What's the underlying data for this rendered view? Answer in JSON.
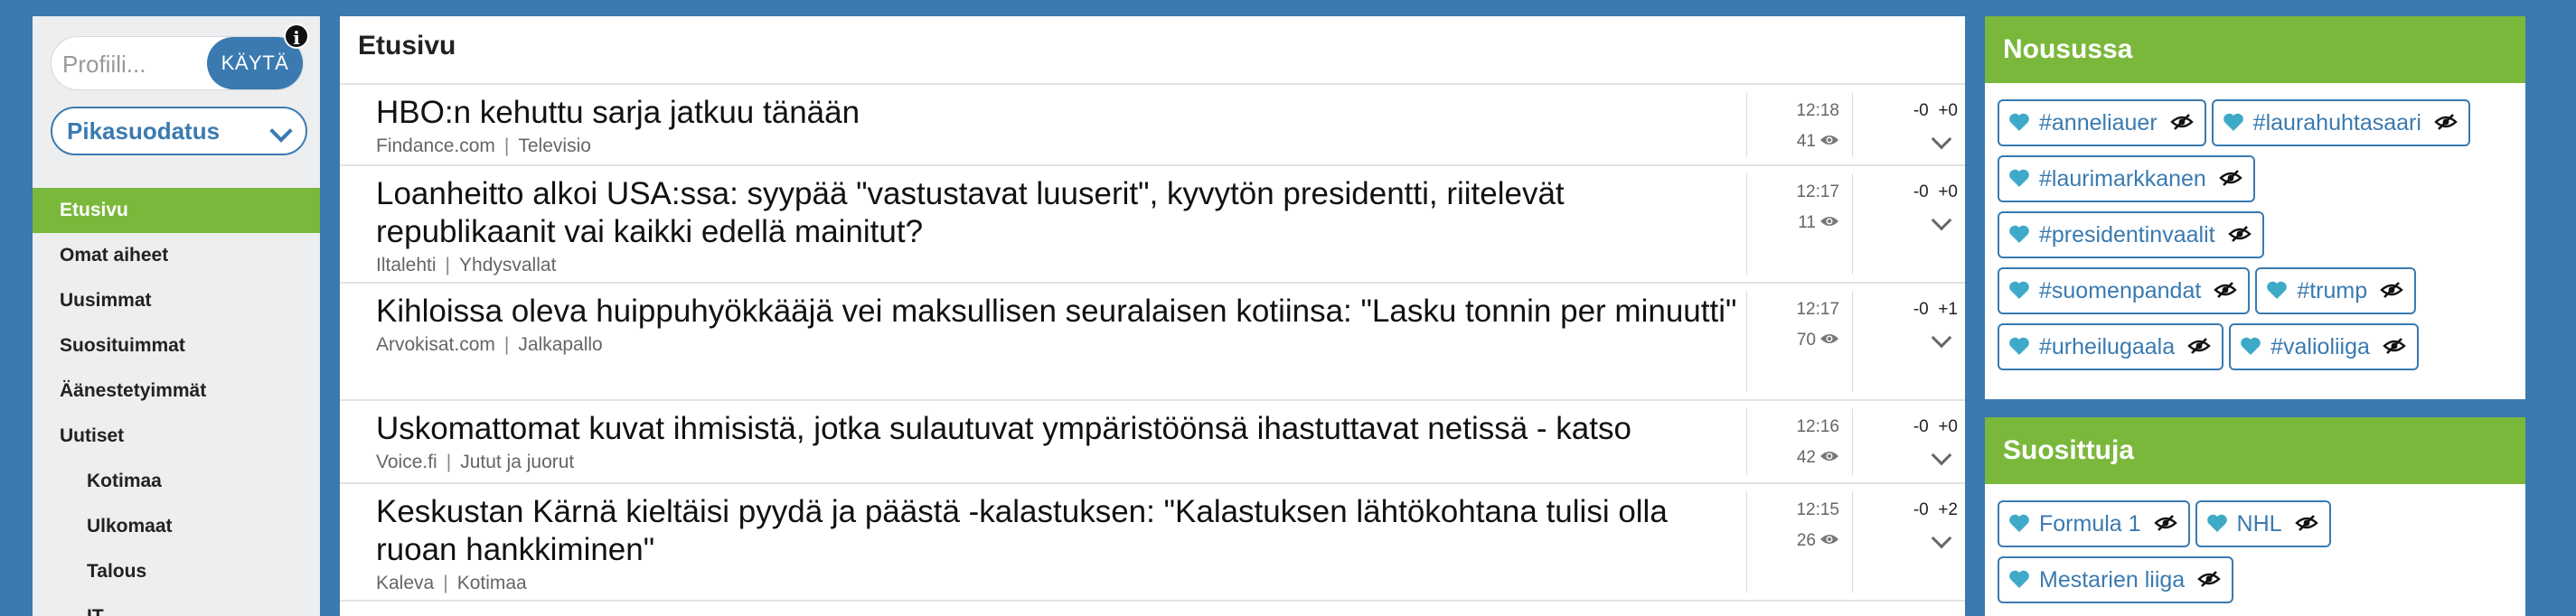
{
  "sidebar": {
    "search": {
      "placeholder": "Profiili...",
      "button_label": "KÄYTÄ"
    },
    "info_icon": "info-icon",
    "quickfilter_label": "Pikasuodatus",
    "nav": [
      {
        "label": "Etusivu",
        "active": true,
        "sub": false
      },
      {
        "label": "Omat aiheet",
        "active": false,
        "sub": false
      },
      {
        "label": "Uusimmat",
        "active": false,
        "sub": false
      },
      {
        "label": "Suosituimmat",
        "active": false,
        "sub": false
      },
      {
        "label": "Äänestetyimmät",
        "active": false,
        "sub": false
      },
      {
        "label": "Uutiset",
        "active": false,
        "sub": false
      },
      {
        "label": "Kotimaa",
        "active": false,
        "sub": true
      },
      {
        "label": "Ulkomaat",
        "active": false,
        "sub": true
      },
      {
        "label": "Talous",
        "active": false,
        "sub": true
      },
      {
        "label": "IT",
        "active": false,
        "sub": true
      }
    ]
  },
  "main": {
    "title": "Etusivu",
    "articles": [
      {
        "title": "HBO:n kehuttu sarja jatkuu tänään",
        "source": "Findance.com",
        "category": "Televisio",
        "time": "12:18",
        "views": "41",
        "down": "-0",
        "up": "+0"
      },
      {
        "title": "Loanheitto alkoi USA:ssa: syypää \"vastustavat luuserit\", kyvytön presidentti, riitelevät republikaanit vai kaikki edellä mainitut?",
        "source": "Iltalehti",
        "category": "Yhdysvallat",
        "time": "12:17",
        "views": "11",
        "down": "-0",
        "up": "+0"
      },
      {
        "title": "Kihloissa oleva huippuhyökkääjä vei maksullisen seuralaisen kotiinsa: \"Lasku tonnin per minuutti\"",
        "source": "Arvokisat.com",
        "category": "Jalkapallo",
        "time": "12:17",
        "views": "70",
        "down": "-0",
        "up": "+1"
      },
      {
        "title": "Uskomattomat kuvat ihmisistä, jotka sulautuvat ympäristöönsä ihastuttavat netissä - katso",
        "source": "Voice.fi",
        "category": "Jutut ja juorut",
        "time": "12:16",
        "views": "42",
        "down": "-0",
        "up": "+0"
      },
      {
        "title": "Keskustan Kärnä kieltäisi pyydä ja päästä -kalastuksen: \"Kalastuksen lähtökohtana tulisi olla ruoan hankkiminen\"",
        "source": "Kaleva",
        "category": "Kotimaa",
        "time": "12:15",
        "views": "26",
        "down": "-0",
        "up": "+2"
      }
    ]
  },
  "trending": {
    "title": "Nousussa",
    "tags": [
      "#anneliauer",
      "#laurahuhtasaari",
      "#laurimarkkanen",
      "#presidentinvaalit",
      "#suomenpandat",
      "#trump",
      "#urheilugaala",
      "#valioliiga"
    ]
  },
  "popular": {
    "title": "Suosittuja",
    "tags": [
      "Formula 1",
      "NHL",
      "Mestarien liiga"
    ]
  },
  "colors": {
    "accent_blue": "#3a7ab0",
    "accent_green": "#7ab83c"
  }
}
